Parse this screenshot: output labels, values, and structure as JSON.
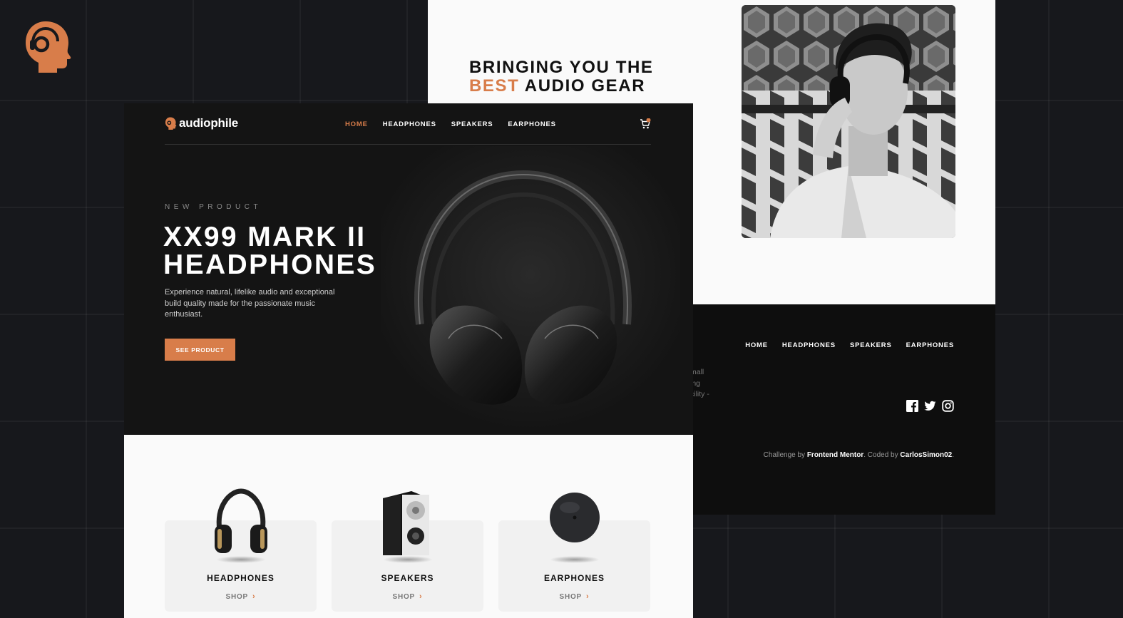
{
  "colors": {
    "accent": "#d87d4a",
    "dark": "#141414",
    "background": "#17181c"
  },
  "about": {
    "title_line1": "BRINGING YOU THE",
    "title_accent": "BEST",
    "title_rest": " AUDIO GEAR"
  },
  "site": {
    "logo": "audiophile",
    "nav": [
      "HOME",
      "HEADPHONES",
      "SPEAKERS",
      "EARPHONES"
    ],
    "active_nav": "HOME",
    "cart_count": "1"
  },
  "hero": {
    "overline": "NEW PRODUCT",
    "title": "XX99 MARK II HEADPHONES",
    "description": "Experience natural, lifelike audio and exceptional build quality made for the passionate music enthusiast.",
    "button": "SEE PRODUCT"
  },
  "categories": [
    {
      "name": "HEADPHONES",
      "shop": "SHOP"
    },
    {
      "name": "SPEAKERS",
      "shop": "SHOP"
    },
    {
      "name": "EARPHONES",
      "shop": "SHOP"
    }
  ],
  "footer": {
    "nav": [
      "HOME",
      "HEADPHONES",
      "SPEAKERS",
      "EARPHONES"
    ],
    "partial_lines": [
      "mall",
      "ing",
      "cility -"
    ],
    "credit_prefix": "Challenge by ",
    "credit_link1": "Frontend Mentor",
    "credit_mid": ". Coded by ",
    "credit_link2": "CarlosSimon02",
    "credit_suffix": ".",
    "social": [
      "facebook-icon",
      "twitter-icon",
      "instagram-icon"
    ]
  },
  "chevron_glyph": "›"
}
